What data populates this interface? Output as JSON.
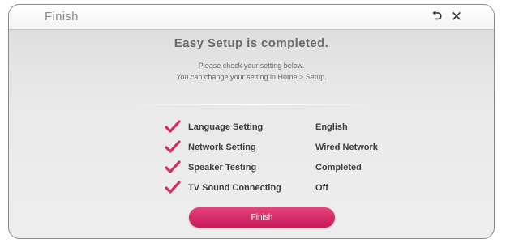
{
  "dialog": {
    "title": "Finish",
    "back_icon": "back-arrow-icon",
    "close_icon": "close-icon"
  },
  "header": {
    "headline": "Easy Setup is completed.",
    "line1": "Please check your setting below.",
    "line2": "You can change your setting in Home > Setup."
  },
  "settings": [
    {
      "label": "Language Setting",
      "value": "English"
    },
    {
      "label": "Network Setting",
      "value": "Wired Network"
    },
    {
      "label": "Speaker Testing",
      "value": "Completed"
    },
    {
      "label": "TV Sound Connecting",
      "value": "Off"
    }
  ],
  "actions": {
    "finish_label": "Finish"
  },
  "colors": {
    "accent": "#d6266a",
    "checkmark": "#d42a6a",
    "text": "#3e3e3e"
  }
}
